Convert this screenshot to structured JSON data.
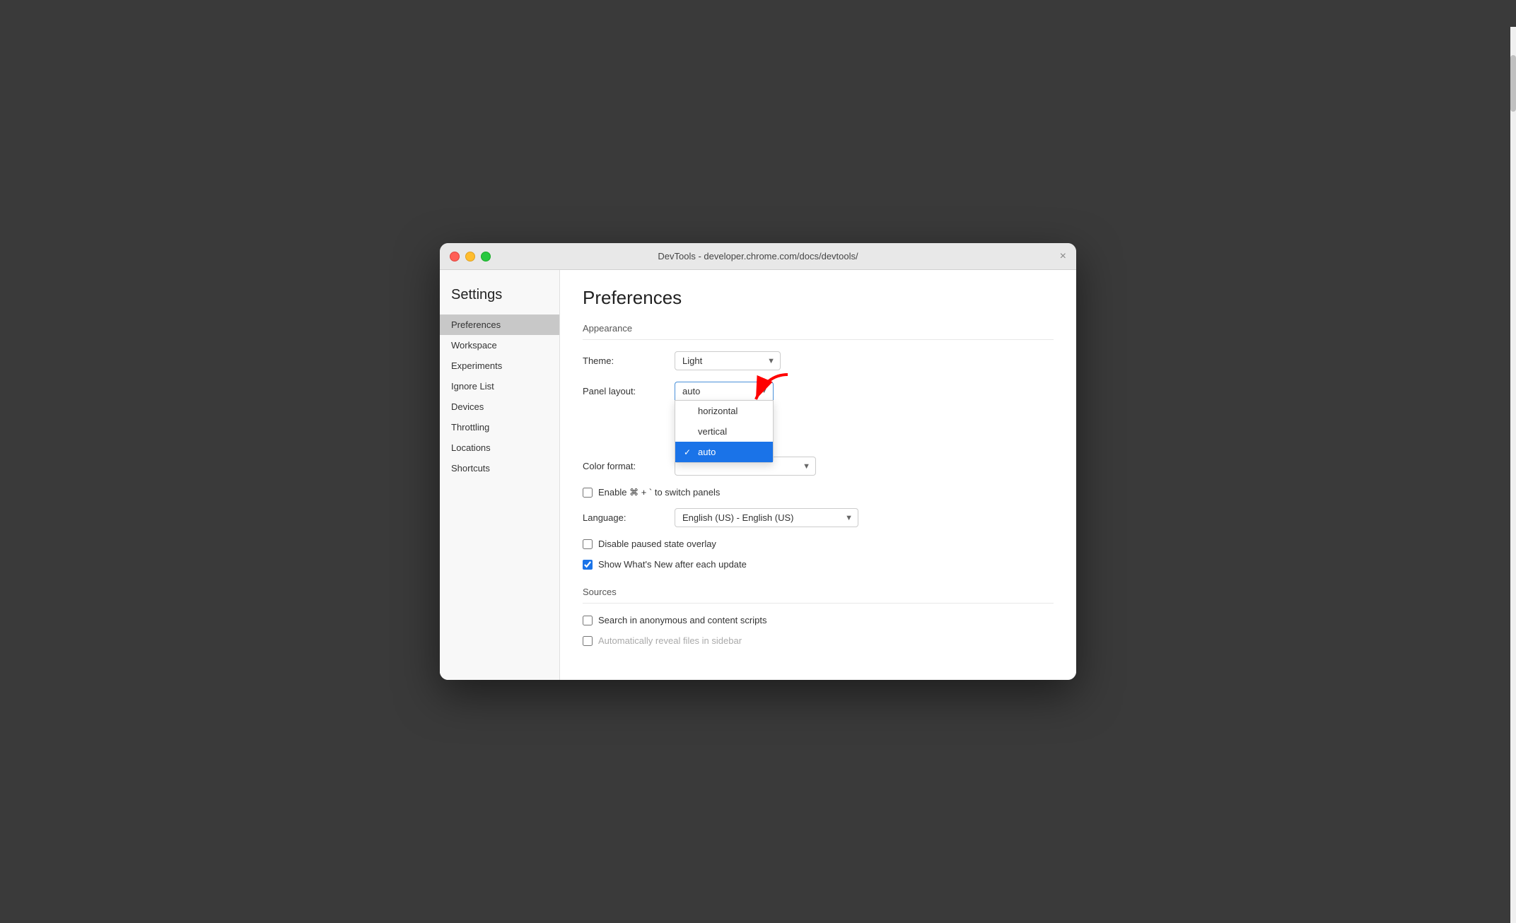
{
  "window": {
    "title": "DevTools - developer.chrome.com/docs/devtools/",
    "close_label": "×"
  },
  "sidebar": {
    "heading": "Settings",
    "items": [
      {
        "id": "preferences",
        "label": "Preferences",
        "active": true
      },
      {
        "id": "workspace",
        "label": "Workspace",
        "active": false
      },
      {
        "id": "experiments",
        "label": "Experiments",
        "active": false
      },
      {
        "id": "ignore-list",
        "label": "Ignore List",
        "active": false
      },
      {
        "id": "devices",
        "label": "Devices",
        "active": false
      },
      {
        "id": "throttling",
        "label": "Throttling",
        "active": false
      },
      {
        "id": "locations",
        "label": "Locations",
        "active": false
      },
      {
        "id": "shortcuts",
        "label": "Shortcuts",
        "active": false
      }
    ]
  },
  "main": {
    "title": "Preferences",
    "sections": {
      "appearance": {
        "heading": "Appearance",
        "theme_label": "Theme:",
        "theme_value": "Light",
        "panel_layout_label": "Panel layout:",
        "panel_layout_value": "auto",
        "color_format_label": "Color format:",
        "color_format_value": "",
        "language_label": "Language:",
        "language_value": "English (US) - English (US)"
      },
      "sources": {
        "heading": "Sources"
      }
    },
    "checkboxes": [
      {
        "id": "enable-switch-panels",
        "label": "Enable ⌘ + ` to switch panels",
        "checked": false
      },
      {
        "id": "disable-paused-overlay",
        "label": "Disable paused state overlay",
        "checked": false
      },
      {
        "id": "show-whats-new",
        "label": "Show What's New after each update",
        "checked": true
      }
    ],
    "sources_checkboxes": [
      {
        "id": "search-anonymous",
        "label": "Search in anonymous and content scripts",
        "checked": false
      },
      {
        "id": "auto-reveal",
        "label": "Automatically reveal files in sidebar",
        "checked": false
      }
    ],
    "dropdown": {
      "options": [
        {
          "value": "horizontal",
          "label": "horizontal",
          "selected": false
        },
        {
          "value": "vertical",
          "label": "vertical",
          "selected": false
        },
        {
          "value": "auto",
          "label": "auto",
          "selected": true
        }
      ]
    }
  }
}
